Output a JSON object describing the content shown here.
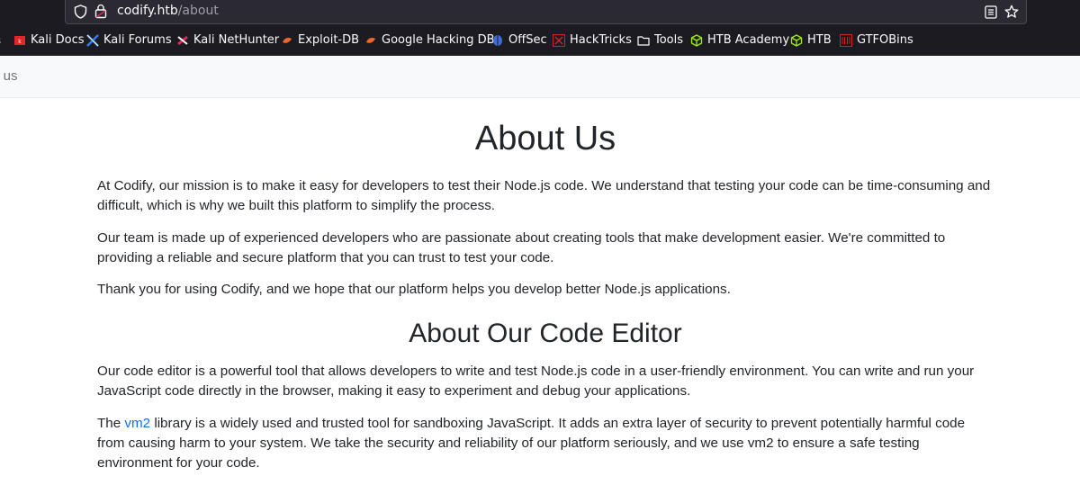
{
  "browser": {
    "url_host": "codify.htb",
    "url_path": "/about",
    "bookmarks": [
      {
        "label": "Kali Docs"
      },
      {
        "label": "Kali Forums"
      },
      {
        "label": "Kali NetHunter"
      },
      {
        "label": "Exploit-DB"
      },
      {
        "label": "Google Hacking DB"
      },
      {
        "label": "OffSec"
      },
      {
        "label": "HackTricks"
      },
      {
        "label": "Tools"
      },
      {
        "label": "HTB Academy"
      },
      {
        "label": "HTB"
      },
      {
        "label": "GTFOBins"
      }
    ]
  },
  "header": {
    "crumb": "ut us"
  },
  "main": {
    "title": "About Us",
    "p1": "At Codify, our mission is to make it easy for developers to test their Node.js code. We understand that testing your code can be time-consuming and difficult, which is why we built this platform to simplify the process.",
    "p2": "Our team is made up of experienced developers who are passionate about creating tools that make development easier. We're committed to providing a reliable and secure platform that you can trust to test your code.",
    "p3": "Thank you for using Codify, and we hope that our platform helps you develop better Node.js applications.",
    "subtitle": "About Our Code Editor",
    "p4": "Our code editor is a powerful tool that allows developers to write and test Node.js code in a user-friendly environment. You can write and run your JavaScript code directly in the browser, making it easy to experiment and debug your applications.",
    "p5_prefix": "The ",
    "p5_link": "vm2",
    "p5_rest": " library is a widely used and trusted tool for sandboxing JavaScript. It adds an extra layer of security to prevent potentially harmful code from causing harm to your system. We take the security and reliability of our platform seriously, and we use vm2 to ensure a safe testing environment for your code."
  },
  "colors": {
    "chrome_bg": "#1c1b22",
    "urlbar_bg": "#2b2a33",
    "link": "#0d6efd",
    "text": "#212529"
  }
}
